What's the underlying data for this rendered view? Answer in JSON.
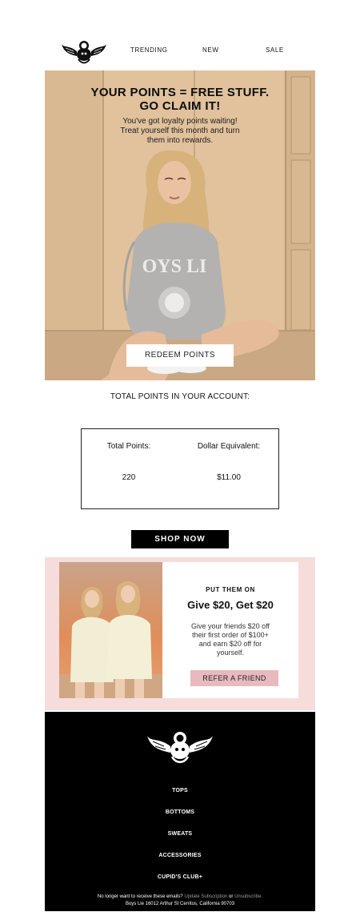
{
  "header": {
    "logo": "cupid-logo-icon",
    "nav": [
      {
        "label": "TRENDING"
      },
      {
        "label": "NEW"
      },
      {
        "label": "SALE"
      }
    ]
  },
  "hero": {
    "title_lines": [
      "YOUR POINTS = FREE STUFF.",
      "GO CLAIM IT!"
    ],
    "subtitle_lines": [
      "You've got loyalty points waiting!",
      "Treat yourself this month and turn",
      "them into rewards."
    ],
    "button_label": "REDEEM POINTS",
    "sweatshirt_text": "OYS LI"
  },
  "points": {
    "heading": "TOTAL POINTS IN YOUR ACCOUNT:",
    "columns": [
      {
        "label": "Total Points:",
        "value": "220"
      },
      {
        "label": "Dollar Equivalent:",
        "value": "$11.00"
      }
    ]
  },
  "shop_now": {
    "label": "SHOP NOW"
  },
  "referral": {
    "kicker": "PUT THEM ON",
    "title": "Give $20, Get $20",
    "body_lines": [
      "Give your friends $20 off",
      "their first order of $100+",
      "and earn $20 off for",
      "yourself."
    ],
    "button_label": "REFER A FRIEND"
  },
  "footer": {
    "logo": "cupid-logo-icon",
    "links": [
      {
        "label": "TOPS"
      },
      {
        "label": "BOTTOMS"
      },
      {
        "label": "SWEATS"
      },
      {
        "label": "ACCESSORIES"
      },
      {
        "label": "CUPID'S CLUB+"
      }
    ],
    "unsubscribe_prefix": "No longer want to receive these emails?",
    "update_link": "Update Subscription",
    "or_text": "or",
    "unsubscribe_link": "Unsubscribe.",
    "address": "Boys Lie 16012 Arthur St Cerritos, California 90703"
  },
  "colors": {
    "hero_bg": "#dcbb94",
    "referral_bg": "#f7dcdc",
    "refer_button": "#e8b9bd",
    "footer_bg": "#000000"
  }
}
